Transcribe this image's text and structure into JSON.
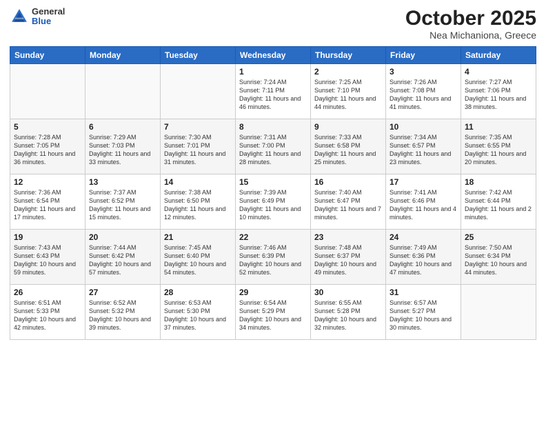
{
  "header": {
    "logo": {
      "general": "General",
      "blue": "Blue"
    },
    "title": "October 2025",
    "subtitle": "Nea Michaniona, Greece"
  },
  "weekdays": [
    "Sunday",
    "Monday",
    "Tuesday",
    "Wednesday",
    "Thursday",
    "Friday",
    "Saturday"
  ],
  "weeks": [
    [
      {
        "day": "",
        "sunrise": "",
        "sunset": "",
        "daylight": ""
      },
      {
        "day": "",
        "sunrise": "",
        "sunset": "",
        "daylight": ""
      },
      {
        "day": "",
        "sunrise": "",
        "sunset": "",
        "daylight": ""
      },
      {
        "day": "1",
        "sunrise": "Sunrise: 7:24 AM",
        "sunset": "Sunset: 7:11 PM",
        "daylight": "Daylight: 11 hours and 46 minutes."
      },
      {
        "day": "2",
        "sunrise": "Sunrise: 7:25 AM",
        "sunset": "Sunset: 7:10 PM",
        "daylight": "Daylight: 11 hours and 44 minutes."
      },
      {
        "day": "3",
        "sunrise": "Sunrise: 7:26 AM",
        "sunset": "Sunset: 7:08 PM",
        "daylight": "Daylight: 11 hours and 41 minutes."
      },
      {
        "day": "4",
        "sunrise": "Sunrise: 7:27 AM",
        "sunset": "Sunset: 7:06 PM",
        "daylight": "Daylight: 11 hours and 38 minutes."
      }
    ],
    [
      {
        "day": "5",
        "sunrise": "Sunrise: 7:28 AM",
        "sunset": "Sunset: 7:05 PM",
        "daylight": "Daylight: 11 hours and 36 minutes."
      },
      {
        "day": "6",
        "sunrise": "Sunrise: 7:29 AM",
        "sunset": "Sunset: 7:03 PM",
        "daylight": "Daylight: 11 hours and 33 minutes."
      },
      {
        "day": "7",
        "sunrise": "Sunrise: 7:30 AM",
        "sunset": "Sunset: 7:01 PM",
        "daylight": "Daylight: 11 hours and 31 minutes."
      },
      {
        "day": "8",
        "sunrise": "Sunrise: 7:31 AM",
        "sunset": "Sunset: 7:00 PM",
        "daylight": "Daylight: 11 hours and 28 minutes."
      },
      {
        "day": "9",
        "sunrise": "Sunrise: 7:33 AM",
        "sunset": "Sunset: 6:58 PM",
        "daylight": "Daylight: 11 hours and 25 minutes."
      },
      {
        "day": "10",
        "sunrise": "Sunrise: 7:34 AM",
        "sunset": "Sunset: 6:57 PM",
        "daylight": "Daylight: 11 hours and 23 minutes."
      },
      {
        "day": "11",
        "sunrise": "Sunrise: 7:35 AM",
        "sunset": "Sunset: 6:55 PM",
        "daylight": "Daylight: 11 hours and 20 minutes."
      }
    ],
    [
      {
        "day": "12",
        "sunrise": "Sunrise: 7:36 AM",
        "sunset": "Sunset: 6:54 PM",
        "daylight": "Daylight: 11 hours and 17 minutes."
      },
      {
        "day": "13",
        "sunrise": "Sunrise: 7:37 AM",
        "sunset": "Sunset: 6:52 PM",
        "daylight": "Daylight: 11 hours and 15 minutes."
      },
      {
        "day": "14",
        "sunrise": "Sunrise: 7:38 AM",
        "sunset": "Sunset: 6:50 PM",
        "daylight": "Daylight: 11 hours and 12 minutes."
      },
      {
        "day": "15",
        "sunrise": "Sunrise: 7:39 AM",
        "sunset": "Sunset: 6:49 PM",
        "daylight": "Daylight: 11 hours and 10 minutes."
      },
      {
        "day": "16",
        "sunrise": "Sunrise: 7:40 AM",
        "sunset": "Sunset: 6:47 PM",
        "daylight": "Daylight: 11 hours and 7 minutes."
      },
      {
        "day": "17",
        "sunrise": "Sunrise: 7:41 AM",
        "sunset": "Sunset: 6:46 PM",
        "daylight": "Daylight: 11 hours and 4 minutes."
      },
      {
        "day": "18",
        "sunrise": "Sunrise: 7:42 AM",
        "sunset": "Sunset: 6:44 PM",
        "daylight": "Daylight: 11 hours and 2 minutes."
      }
    ],
    [
      {
        "day": "19",
        "sunrise": "Sunrise: 7:43 AM",
        "sunset": "Sunset: 6:43 PM",
        "daylight": "Daylight: 10 hours and 59 minutes."
      },
      {
        "day": "20",
        "sunrise": "Sunrise: 7:44 AM",
        "sunset": "Sunset: 6:42 PM",
        "daylight": "Daylight: 10 hours and 57 minutes."
      },
      {
        "day": "21",
        "sunrise": "Sunrise: 7:45 AM",
        "sunset": "Sunset: 6:40 PM",
        "daylight": "Daylight: 10 hours and 54 minutes."
      },
      {
        "day": "22",
        "sunrise": "Sunrise: 7:46 AM",
        "sunset": "Sunset: 6:39 PM",
        "daylight": "Daylight: 10 hours and 52 minutes."
      },
      {
        "day": "23",
        "sunrise": "Sunrise: 7:48 AM",
        "sunset": "Sunset: 6:37 PM",
        "daylight": "Daylight: 10 hours and 49 minutes."
      },
      {
        "day": "24",
        "sunrise": "Sunrise: 7:49 AM",
        "sunset": "Sunset: 6:36 PM",
        "daylight": "Daylight: 10 hours and 47 minutes."
      },
      {
        "day": "25",
        "sunrise": "Sunrise: 7:50 AM",
        "sunset": "Sunset: 6:34 PM",
        "daylight": "Daylight: 10 hours and 44 minutes."
      }
    ],
    [
      {
        "day": "26",
        "sunrise": "Sunrise: 6:51 AM",
        "sunset": "Sunset: 5:33 PM",
        "daylight": "Daylight: 10 hours and 42 minutes."
      },
      {
        "day": "27",
        "sunrise": "Sunrise: 6:52 AM",
        "sunset": "Sunset: 5:32 PM",
        "daylight": "Daylight: 10 hours and 39 minutes."
      },
      {
        "day": "28",
        "sunrise": "Sunrise: 6:53 AM",
        "sunset": "Sunset: 5:30 PM",
        "daylight": "Daylight: 10 hours and 37 minutes."
      },
      {
        "day": "29",
        "sunrise": "Sunrise: 6:54 AM",
        "sunset": "Sunset: 5:29 PM",
        "daylight": "Daylight: 10 hours and 34 minutes."
      },
      {
        "day": "30",
        "sunrise": "Sunrise: 6:55 AM",
        "sunset": "Sunset: 5:28 PM",
        "daylight": "Daylight: 10 hours and 32 minutes."
      },
      {
        "day": "31",
        "sunrise": "Sunrise: 6:57 AM",
        "sunset": "Sunset: 5:27 PM",
        "daylight": "Daylight: 10 hours and 30 minutes."
      },
      {
        "day": "",
        "sunrise": "",
        "sunset": "",
        "daylight": ""
      }
    ]
  ]
}
